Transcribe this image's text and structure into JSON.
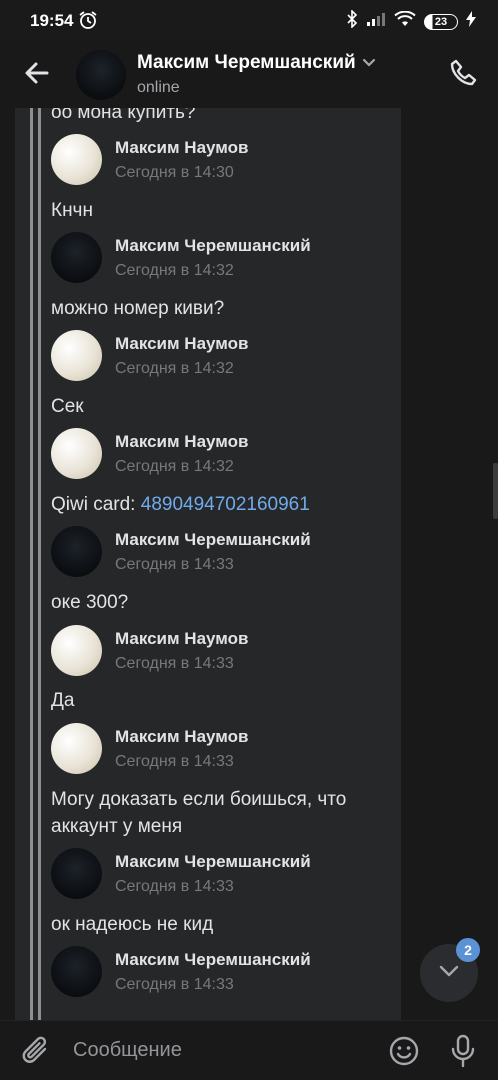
{
  "status_bar": {
    "time": "19:54",
    "battery": "23"
  },
  "header": {
    "name": "Максим Черемшанский",
    "status": "online"
  },
  "messages": [
    {
      "type": "text",
      "text": "оо мона купить?"
    },
    {
      "type": "head",
      "author": "Максим Наумов",
      "time": "Сегодня в 14:30",
      "avatar": "light"
    },
    {
      "type": "text",
      "text": "Кнчн"
    },
    {
      "type": "head",
      "author": "Максим Черемшанский",
      "time": "Сегодня в 14:32",
      "avatar": "dark"
    },
    {
      "type": "text",
      "text": "можно номер киви?"
    },
    {
      "type": "head",
      "author": "Максим Наумов",
      "time": "Сегодня в 14:32",
      "avatar": "light"
    },
    {
      "type": "text",
      "text": "Сек"
    },
    {
      "type": "head",
      "author": "Максим Наумов",
      "time": "Сегодня в 14:32",
      "avatar": "light"
    },
    {
      "type": "card",
      "prefix": "Qiwi card: ",
      "link": "4890494702160961"
    },
    {
      "type": "head",
      "author": "Максим Черемшанский",
      "time": "Сегодня в 14:33",
      "avatar": "dark"
    },
    {
      "type": "text",
      "text": "оке 300?"
    },
    {
      "type": "head",
      "author": "Максим Наумов",
      "time": "Сегодня в 14:33",
      "avatar": "light"
    },
    {
      "type": "text",
      "text": "Да"
    },
    {
      "type": "head",
      "author": "Максим Наумов",
      "time": "Сегодня в 14:33",
      "avatar": "light"
    },
    {
      "type": "text2",
      "line1": "Могу доказать если боишься, что",
      "line2": "аккаунт у меня"
    },
    {
      "type": "head",
      "author": "Максим Черемшанский",
      "time": "Сегодня в 14:33",
      "avatar": "dark"
    },
    {
      "type": "text",
      "text": "ок надеюсь не кид"
    },
    {
      "type": "head",
      "author": "Максим Черемшанский",
      "time": "Сегодня в 14:33",
      "avatar": "dark"
    }
  ],
  "scroll_down": {
    "badge": "2"
  },
  "input": {
    "placeholder": "Сообщение"
  }
}
